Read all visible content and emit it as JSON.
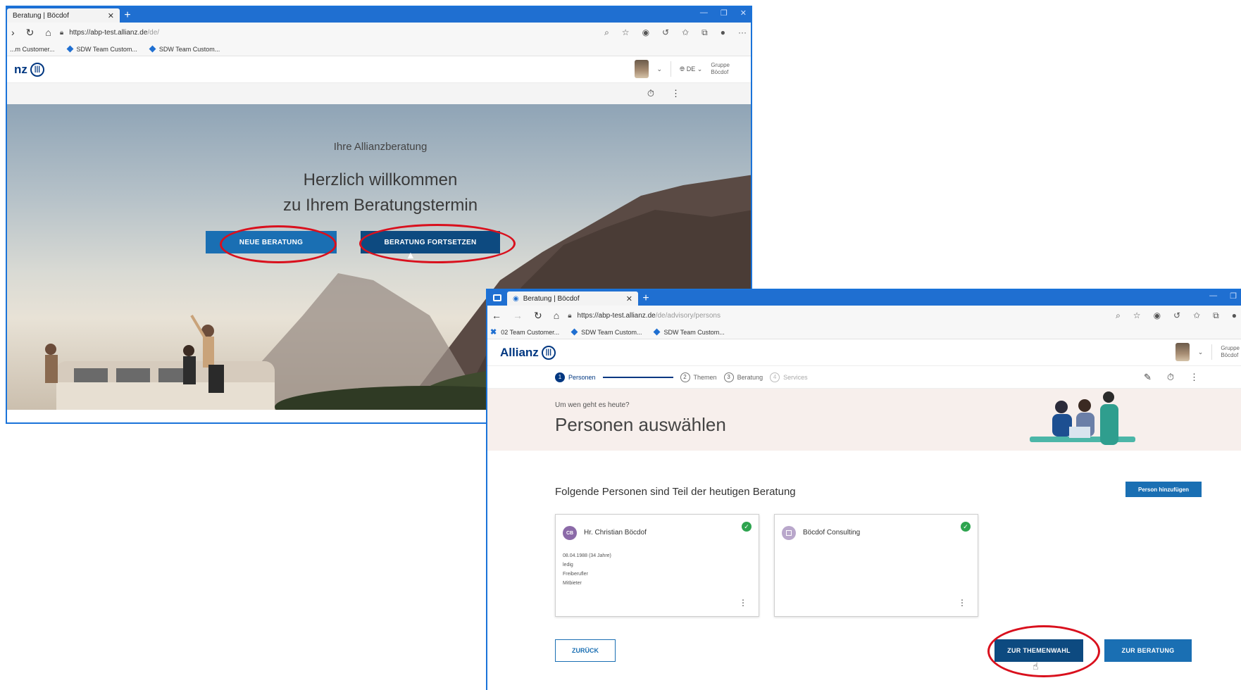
{
  "left_window": {
    "tab_title": "Beratung | Böcdof",
    "url": {
      "prefix": "https://abp-test.allianz.de",
      "path": "/de/"
    },
    "bookmarks": [
      "...m Customer...",
      "SDW Team Custom...",
      "SDW Team Custom..."
    ],
    "header": {
      "logo_text": "nz",
      "lang": "DE",
      "group_line1": "Gruppe",
      "group_line2": "Böcdof"
    },
    "hero": {
      "kicker": "Ihre Allianzberatung",
      "title_line1": "Herzlich willkommen",
      "title_line2": "zu Ihrem Beratungstermin"
    },
    "buttons": {
      "new": "NEUE BERATUNG",
      "continue": "BERATUNG FORTSETZEN"
    }
  },
  "right_window": {
    "tab_title": "Beratung | Böcdof",
    "url": {
      "prefix": "https://abp-test.allianz.de",
      "path": "/de/advisory/persons"
    },
    "bookmarks": [
      "02 Team Customer...",
      "SDW Team Custom...",
      "SDW Team Custom..."
    ],
    "header": {
      "logo_text": "Allianz",
      "group_line1": "Gruppe",
      "group_line2": "Böcdof"
    },
    "steps": [
      {
        "num": "1",
        "label": "Personen"
      },
      {
        "num": "2",
        "label": "Themen"
      },
      {
        "num": "3",
        "label": "Beratung"
      },
      {
        "num": "4",
        "label": "Services"
      }
    ],
    "banner": {
      "kicker": "Um wen geht es heute?",
      "title": "Personen auswählen"
    },
    "section_title": "Folgende Personen sind Teil der heutigen Beratung",
    "add_person": "Person hinzufügen",
    "cards": [
      {
        "initials": "CB",
        "name": "Hr. Christian Böcdof",
        "details": [
          "08.04.1988 (34 Jahre)",
          "ledig",
          "Freiberufler",
          "Mitbieter"
        ]
      },
      {
        "initials": "",
        "name": "Böcdof Consulting",
        "details": []
      }
    ],
    "buttons": {
      "back": "ZURÜCK",
      "topics": "ZUR THEMENWAHL",
      "advisory": "ZUR BERATUNG"
    }
  },
  "colors": {
    "allianz_blue": "#003781",
    "button_blue": "#1a6fb3",
    "edge_blue": "#1f6fd1",
    "annotation_red": "#d9101d",
    "check_green": "#2ea44f"
  }
}
